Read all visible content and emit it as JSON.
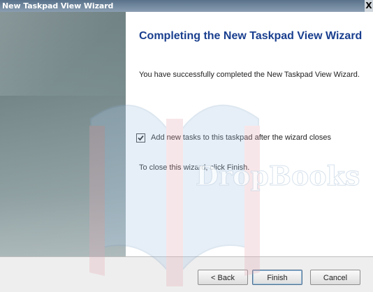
{
  "window": {
    "title": "New Taskpad View Wizard",
    "close_glyph": "X",
    "close_icon": "close-icon"
  },
  "content": {
    "heading": "Completing the New Taskpad View Wizard",
    "message": "You have successfully completed the New Taskpad View Wizard.",
    "checkbox": {
      "label": "Add new tasks to this taskpad after the wizard closes",
      "checked": true
    },
    "instruction": "To close this wizard, click Finish."
  },
  "buttons": {
    "back": "< Back",
    "finish": "Finish",
    "cancel": "Cancel"
  },
  "watermark": {
    "text": "DropBooks"
  },
  "colors": {
    "heading": "#1a3f8f",
    "sidebar": "#7c8f91",
    "watermark_blue": "#a9c8e8",
    "watermark_red": "#e4a8b4"
  }
}
